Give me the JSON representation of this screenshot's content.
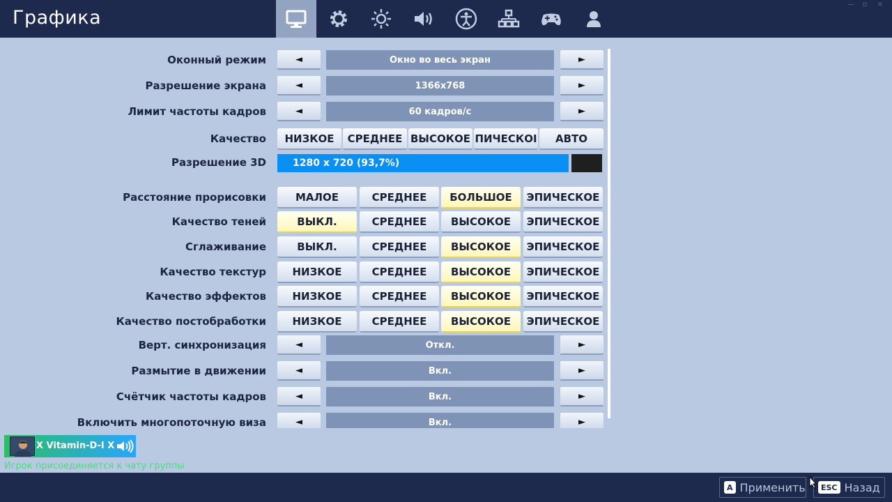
{
  "header": {
    "title": "Графика",
    "tabs": [
      {
        "id": "video",
        "icon": "monitor-icon"
      },
      {
        "id": "game",
        "icon": "gear-icon"
      },
      {
        "id": "brightness",
        "icon": "brightness-icon"
      },
      {
        "id": "audio",
        "icon": "speaker-icon"
      },
      {
        "id": "accessibility",
        "icon": "accessibility-icon"
      },
      {
        "id": "input",
        "icon": "network-icon"
      },
      {
        "id": "controller",
        "icon": "gamepad-icon"
      },
      {
        "id": "account",
        "icon": "user-icon"
      }
    ]
  },
  "settings": {
    "window_mode": {
      "label": "Оконный режим",
      "value": "Окно во весь экран"
    },
    "resolution": {
      "label": "Разрешение экрана",
      "value": "1366x768"
    },
    "fps_limit": {
      "label": "Лимит частоты кадров",
      "value": "60 кадров/с"
    },
    "quality": {
      "label": "Качество",
      "options": [
        "НИЗКОЕ",
        "СРЕДНЕЕ",
        "ВЫСОКОЕ",
        "ПИЧЕСКОI",
        "АВТО"
      ]
    },
    "res3d": {
      "label": "Разрешение 3D",
      "value": "1280 x 720 (93,7%)"
    },
    "view_distance": {
      "label": "Расстояние прорисовки",
      "options": [
        "МАЛОЕ",
        "СРЕДНЕЕ",
        "БОЛЬШОЕ",
        "ЭПИЧЕСКОЕ"
      ],
      "selected": 2
    },
    "shadows": {
      "label": "Качество теней",
      "options": [
        "ВЫКЛ.",
        "СРЕДНЕЕ",
        "ВЫСОКОЕ",
        "ЭПИЧЕСКОЕ"
      ],
      "selected": 0
    },
    "anti_aliasing": {
      "label": "Сглаживание",
      "options": [
        "ВЫКЛ.",
        "СРЕДНЕЕ",
        "ВЫСОКОЕ",
        "ЭПИЧЕСКОЕ"
      ],
      "selected": 2
    },
    "textures": {
      "label": "Качество текстур",
      "options": [
        "НИЗКОЕ",
        "СРЕДНЕЕ",
        "ВЫСОКОЕ",
        "ЭПИЧЕСКОЕ"
      ],
      "selected": 2
    },
    "effects": {
      "label": "Качество эффектов",
      "options": [
        "НИЗКОЕ",
        "СРЕДНЕЕ",
        "ВЫСОКОЕ",
        "ЭПИЧЕСКОЕ"
      ],
      "selected": 2
    },
    "post_processing": {
      "label": "Качество постобработки",
      "options": [
        "НИЗКОЕ",
        "СРЕДНЕЕ",
        "ВЫСОКОЕ",
        "ЭПИЧЕСКОЕ"
      ],
      "selected": 2
    },
    "vsync": {
      "label": "Верт. синхронизация",
      "value": "Откл."
    },
    "motion_blur": {
      "label": "Размытие в движении",
      "value": "Вкл."
    },
    "fps_counter": {
      "label": "Счётчик частоты кадров",
      "value": "Вкл."
    },
    "multithread": {
      "label": "Включить многопоточную виза",
      "value": "Вкл."
    }
  },
  "arrows": {
    "left": "◄",
    "right": "►"
  },
  "chat": {
    "player_name": "X Vitamin-D-I X",
    "message": "Игрок присоединяется к чату группы"
  },
  "footer": {
    "apply": {
      "key": "A",
      "label": "Применить"
    },
    "back": {
      "key": "ESC",
      "label": "Назад"
    }
  },
  "colors": {
    "background": "#b9c9e2",
    "header": "#1d2a4d",
    "value_box": "#7f93b6",
    "res3d_bar": "#0a8ff4",
    "selected": "#fff6b8"
  }
}
